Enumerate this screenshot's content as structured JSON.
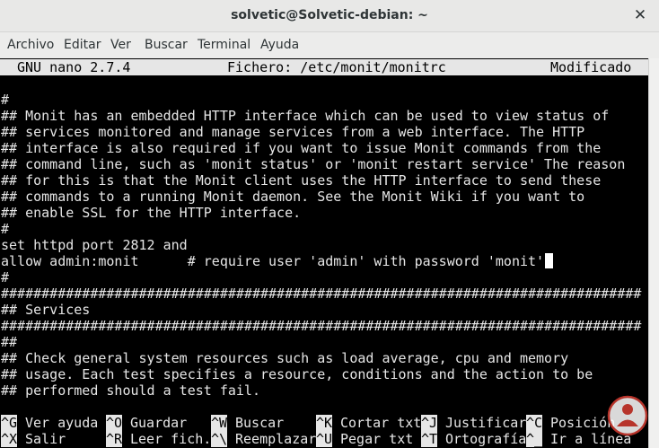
{
  "window": {
    "title": "solvetic@Solvetic-debian: ~",
    "close_label": "✕"
  },
  "menubar": {
    "items": [
      "Archivo",
      "Editar",
      "Ver",
      "Buscar",
      "Terminal",
      "Ayuda"
    ]
  },
  "nano": {
    "version": "GNU nano 2.7.4",
    "file": "Fichero: /etc/monit/monitrc",
    "state": "Modificado"
  },
  "editor": {
    "lines": [
      "",
      "#",
      "## Monit has an embedded HTTP interface which can be used to view status of",
      "## services monitored and manage services from a web interface. The HTTP",
      "## interface is also required if you want to issue Monit commands from the",
      "## command line, such as 'monit status' or 'monit restart service' The reason",
      "## for this is that the Monit client uses the HTTP interface to send these",
      "## commands to a running Monit daemon. See the Monit Wiki if you want to",
      "## enable SSL for the HTTP interface.",
      "#",
      "set httpd port 2812 and",
      "allow admin:monit      # require user 'admin' with password 'monit'",
      "#",
      "###############################################################################",
      "## Services",
      "###############################################################################",
      "##",
      "## Check general system resources such as load average, cpu and memory",
      "## usage. Each test specifies a resource, conditions and the action to be",
      "## performed should a test fail.",
      ""
    ]
  },
  "shortcuts": {
    "row1": [
      {
        "key": "^G",
        "label": "Ver ayuda"
      },
      {
        "key": "^O",
        "label": "Guardar"
      },
      {
        "key": "^W",
        "label": "Buscar"
      },
      {
        "key": "^K",
        "label": "Cortar txt"
      },
      {
        "key": "^J",
        "label": "Justificar"
      },
      {
        "key": "^C",
        "label": "Posición"
      }
    ],
    "row2": [
      {
        "key": "^X",
        "label": "Salir"
      },
      {
        "key": "^R",
        "label": "Leer fich."
      },
      {
        "key": "^\\",
        "label": "Reemplazar"
      },
      {
        "key": "^U",
        "label": "Pegar txt"
      },
      {
        "key": "^T",
        "label": "Ortografía"
      },
      {
        "key": "^_",
        "label": "Ir a línea"
      }
    ]
  },
  "colors": {
    "terminal_bg": "#000000",
    "terminal_fg": "#e6e6e6",
    "chrome_bg": "#e8e8e7",
    "watermark": "#b7342b"
  }
}
